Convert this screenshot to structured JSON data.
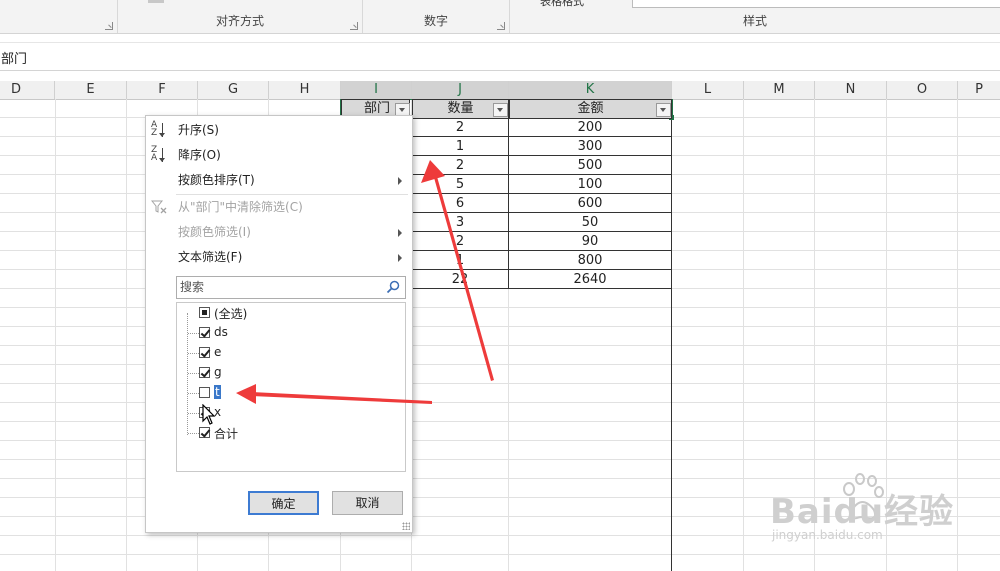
{
  "ribbon": {
    "alignment_group": "对齐方式",
    "number_group": "数字",
    "style_group": "样式",
    "table_style_cut": "表格格式"
  },
  "formula_bar": {
    "content": "部门"
  },
  "columns": [
    "D",
    "E",
    "F",
    "G",
    "H",
    "I",
    "J",
    "K",
    "L",
    "M",
    "N",
    "O",
    "P"
  ],
  "table": {
    "headers": [
      "部门",
      "数量",
      "金额"
    ],
    "qty": [
      "2",
      "1",
      "2",
      "5",
      "6",
      "3",
      "2",
      "1",
      "22"
    ],
    "amount": [
      "200",
      "300",
      "500",
      "100",
      "600",
      "50",
      "90",
      "800",
      "2640"
    ]
  },
  "filter_menu": {
    "sort_asc": "升序(S)",
    "sort_desc": "降序(O)",
    "sort_by_color": "按颜色排序(T)",
    "clear_filter": "从\"部门\"中清除筛选(C)",
    "filter_by_color": "按颜色筛选(I)",
    "text_filter": "文本筛选(F)",
    "search_placeholder": "搜索",
    "items": [
      {
        "label": "(全选)",
        "state": "partial"
      },
      {
        "label": "ds",
        "state": "checked"
      },
      {
        "label": "e",
        "state": "checked"
      },
      {
        "label": "g",
        "state": "checked"
      },
      {
        "label": "t",
        "state": "unchecked"
      },
      {
        "label": "x",
        "state": "checked"
      },
      {
        "label": "合计",
        "state": "checked"
      }
    ],
    "ok": "确定",
    "cancel": "取消"
  },
  "watermark": {
    "brand": "Baidu经验",
    "url": "jingyan.baidu.com"
  },
  "colors": {
    "selection": "#3a78c9",
    "annotation": "#ee3b3b",
    "header_fill": "#d9d9d9",
    "excel_green": "#217346"
  }
}
